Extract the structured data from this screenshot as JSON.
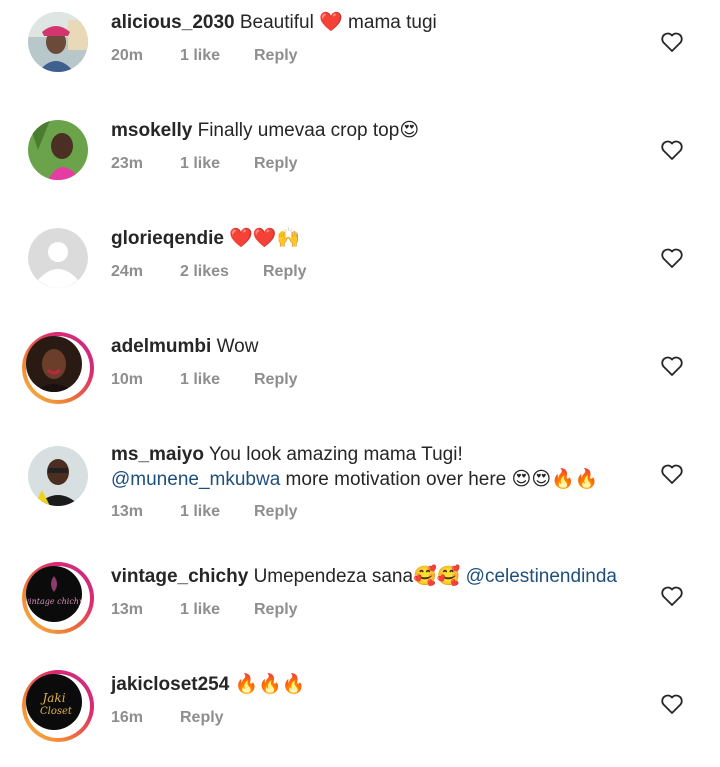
{
  "comments": [
    {
      "username": "alicious_2030",
      "text_parts": [
        "Beautiful ",
        "❤️",
        " mama tugi"
      ],
      "time": "20m",
      "likes": "1 like",
      "reply": "Reply"
    },
    {
      "username": "msokelly",
      "text_parts": [
        "Finally umevaa crop top",
        "😍"
      ],
      "time": "23m",
      "likes": "1 like",
      "reply": "Reply"
    },
    {
      "username": "glorieqendie",
      "text_parts": [
        "❤️❤️🙌"
      ],
      "time": "24m",
      "likes": "2 likes",
      "reply": "Reply"
    },
    {
      "username": "adelmumbi",
      "text_parts": [
        "Wow"
      ],
      "time": "10m",
      "likes": "1 like",
      "reply": "Reply"
    },
    {
      "username": "ms_maiyo",
      "text_parts": [
        "You look amazing mama Tugi!"
      ],
      "line2_mention": "@munene_mkubwa",
      "line2_text": " more motivation over here 😍😍🔥🔥",
      "time": "13m",
      "likes": "1 like",
      "reply": "Reply"
    },
    {
      "username": "vintage_chichy",
      "text_parts": [
        "Umependeza sana🥰🥰 "
      ],
      "mention": "@celestinendinda",
      "time": "13m",
      "likes": "1 like",
      "reply": "Reply"
    },
    {
      "username": "jakicloset254",
      "text_parts": [
        "🔥🔥🔥"
      ],
      "time": "16m",
      "likes": "",
      "reply": "Reply"
    }
  ],
  "avatars": {
    "vintage_chichy_logo": "vintage chichy",
    "jakicloset_logo_line1": "Jaki",
    "jakicloset_logo_line2": "Closet"
  },
  "icons": {
    "like": "heart-outline-icon"
  },
  "colors": {
    "text": "#262626",
    "meta": "#8e8e8e",
    "mention": "#1d4f7c",
    "heart": "#262626"
  }
}
